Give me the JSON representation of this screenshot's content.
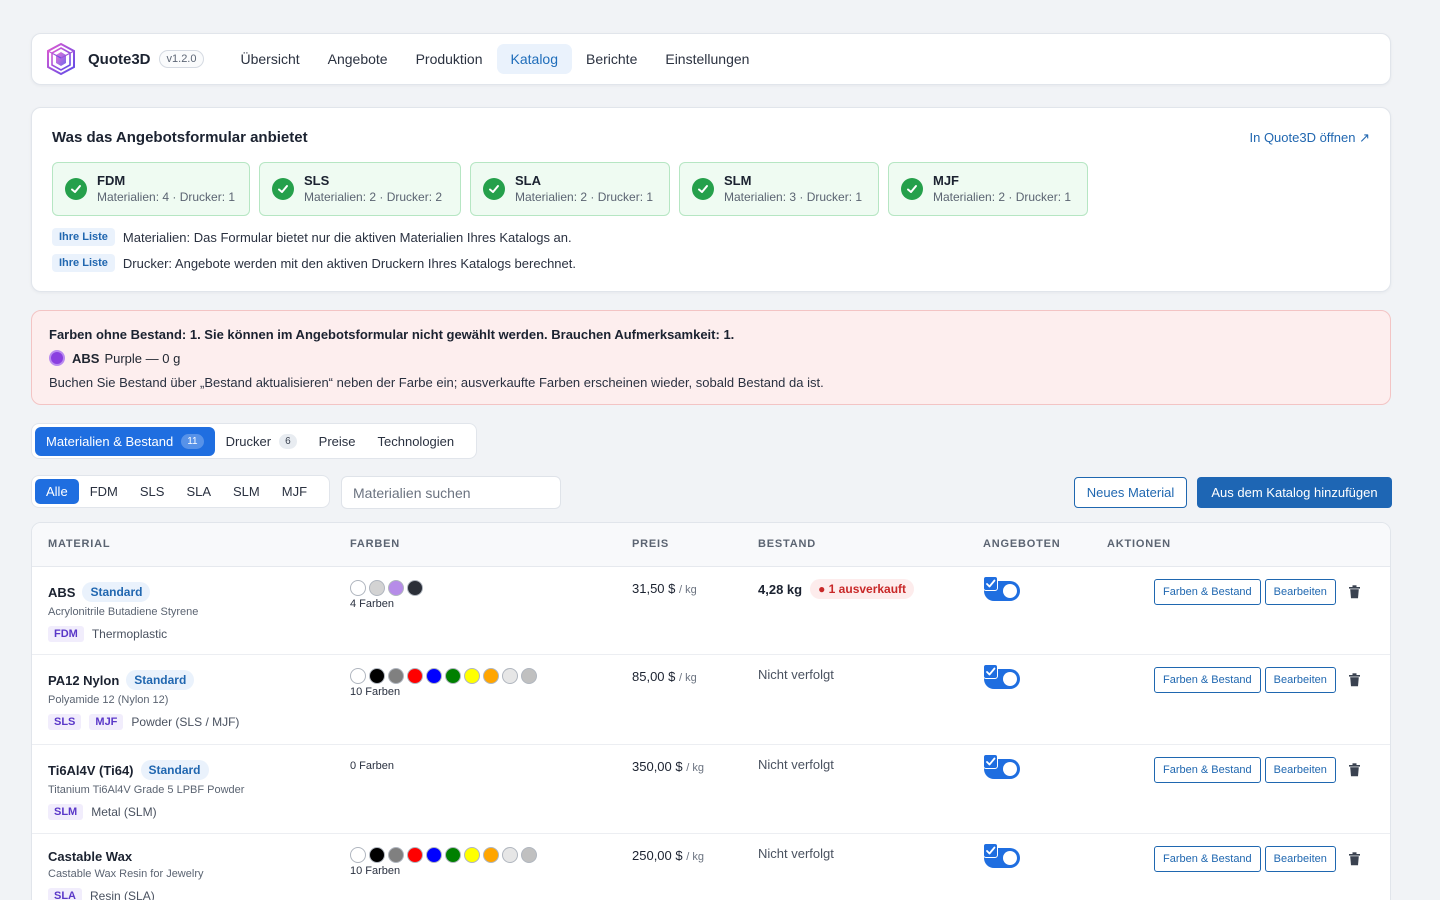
{
  "app": {
    "name": "Quote3D",
    "version": "v1.2.0"
  },
  "nav": [
    {
      "label": "Übersicht",
      "active": false
    },
    {
      "label": "Angebote",
      "active": false
    },
    {
      "label": "Produktion",
      "active": false
    },
    {
      "label": "Katalog",
      "active": true
    },
    {
      "label": "Berichte",
      "active": false
    },
    {
      "label": "Einstellungen",
      "active": false
    }
  ],
  "info": {
    "title": "Was das Angebotsformular anbietet",
    "open_link": "In Quote3D öffnen ↗",
    "technologies": [
      {
        "name": "FDM",
        "meta": "Materialien: 4 · Drucker: 1"
      },
      {
        "name": "SLS",
        "meta": "Materialien: 2 · Drucker: 2"
      },
      {
        "name": "SLA",
        "meta": "Materialien: 2 · Drucker: 1"
      },
      {
        "name": "SLM",
        "meta": "Materialien: 3 · Drucker: 1"
      },
      {
        "name": "MJF",
        "meta": "Materialien: 2 · Drucker: 1"
      }
    ],
    "list_tag": "Ihre Liste",
    "list_lines": [
      "Materialien: Das Formular bietet nur die aktiven Materialien Ihres Katalogs an.",
      "Drucker: Angebote werden mit den aktiven Druckern Ihres Katalogs berechnet."
    ]
  },
  "warning": {
    "title": "Farben ohne Bestand: 1. Sie können im Angebotsformular nicht gewählt werden. Brauchen Aufmerksamkeit: 1.",
    "item_material": "ABS",
    "item_detail": "Purple — 0 g",
    "item_color": "#8a3fe0",
    "description": "Buchen Sie Bestand über „Bestand aktualisieren“ neben der Farbe ein; ausverkaufte Farben erscheinen wieder, sobald Bestand da ist."
  },
  "tabs": [
    {
      "label": "Materialien & Bestand",
      "count": "11",
      "active": true
    },
    {
      "label": "Drucker",
      "count": "6",
      "active": false
    },
    {
      "label": "Preise",
      "count": "",
      "active": false
    },
    {
      "label": "Technologien",
      "count": "",
      "active": false
    }
  ],
  "filters": [
    {
      "label": "Alle",
      "active": true
    },
    {
      "label": "FDM",
      "active": false
    },
    {
      "label": "SLS",
      "active": false
    },
    {
      "label": "SLA",
      "active": false
    },
    {
      "label": "SLM",
      "active": false
    },
    {
      "label": "MJF",
      "active": false
    }
  ],
  "search": {
    "placeholder": "Materialien suchen",
    "value": ""
  },
  "buttons": {
    "new_material": "Neues Material",
    "add_from_catalog": "Aus dem Katalog hinzufügen"
  },
  "table": {
    "headers": [
      "MATERIAL",
      "FARBEN",
      "PREIS",
      "BESTAND",
      "ANGEBOTEN",
      "AKTIONEN"
    ],
    "action_colors": "Farben & Bestand",
    "action_edit": "Bearbeiten",
    "rows": [
      {
        "name": "ABS",
        "badge": "Standard",
        "description": "Acrylonitrile Butadiene Styrene",
        "tech_tags": [
          "FDM"
        ],
        "category": "Thermoplastic",
        "colors": [
          "#ffffff",
          "#d3d3d3",
          "#b68ce8",
          "#2b2f38"
        ],
        "color_count": "4 Farben",
        "price": "31,50 $",
        "price_unit": "/ kg",
        "stock": "4,28 kg",
        "stock_alert": "● 1 ausverkauft",
        "offered": true
      },
      {
        "name": "PA12 Nylon",
        "badge": "Standard",
        "description": "Polyamide 12 (Nylon 12)",
        "tech_tags": [
          "SLS",
          "MJF"
        ],
        "category": "Powder (SLS / MJF)",
        "colors": [
          "#ffffff",
          "#000000",
          "#808080",
          "#ff0000",
          "#0000ff",
          "#008000",
          "#ffff00",
          "#ffa500",
          "#e6e6e6",
          "#c0c0c0"
        ],
        "color_count": "10 Farben",
        "price": "85,00 $",
        "price_unit": "/ kg",
        "stock": "Nicht verfolgt",
        "stock_alert": "",
        "offered": true
      },
      {
        "name": "Ti6Al4V (Ti64)",
        "badge": "Standard",
        "description": "Titanium Ti6Al4V Grade 5 LPBF Powder",
        "tech_tags": [
          "SLM"
        ],
        "category": "Metal (SLM)",
        "colors": [],
        "color_count": "0 Farben",
        "price": "350,00 $",
        "price_unit": "/ kg",
        "stock": "Nicht verfolgt",
        "stock_alert": "",
        "offered": true
      },
      {
        "name": "Castable Wax",
        "badge": "",
        "description": "Castable Wax Resin for Jewelry",
        "tech_tags": [
          "SLA"
        ],
        "category": "Resin (SLA)",
        "colors": [
          "#ffffff",
          "#000000",
          "#808080",
          "#ff0000",
          "#0000ff",
          "#008000",
          "#ffff00",
          "#ffa500",
          "#e6e6e6",
          "#c0c0c0"
        ],
        "color_count": "10 Farben",
        "price": "250,00 $",
        "price_unit": "/ kg",
        "stock": "Nicht verfolgt",
        "stock_alert": "",
        "offered": true
      }
    ]
  }
}
